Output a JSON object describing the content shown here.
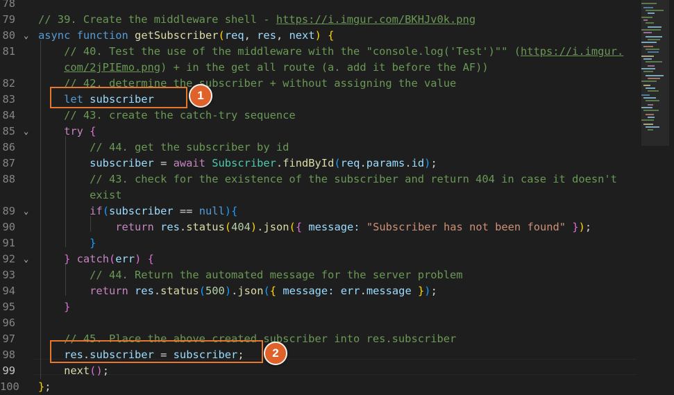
{
  "editor": {
    "language": "javascript",
    "current_line": 99,
    "lines": [
      {
        "num": "78",
        "tokens": []
      },
      {
        "num": "79",
        "fold": false,
        "tokens": [
          {
            "c": "cm",
            "t": "// 39. Create the middleware shell - "
          },
          {
            "c": "ln-link",
            "t": "https://i.imgur.com/BKHJv0k.png"
          }
        ]
      },
      {
        "num": "80",
        "fold": true,
        "tokens": [
          {
            "c": "kw",
            "t": "async"
          },
          {
            "c": "pn",
            "t": " "
          },
          {
            "c": "kw",
            "t": "function"
          },
          {
            "c": "pn",
            "t": " "
          },
          {
            "c": "fn",
            "t": "getSubscriber"
          },
          {
            "c": "br1",
            "t": "("
          },
          {
            "c": "vr",
            "t": "req"
          },
          {
            "c": "pn",
            "t": ", "
          },
          {
            "c": "vr",
            "t": "res"
          },
          {
            "c": "pn",
            "t": ", "
          },
          {
            "c": "vr",
            "t": "next"
          },
          {
            "c": "br1",
            "t": ")"
          },
          {
            "c": "pn",
            "t": " "
          },
          {
            "c": "br1",
            "t": "{"
          }
        ]
      },
      {
        "num": "81",
        "tokens": [
          {
            "c": "pn",
            "t": "    "
          },
          {
            "c": "cm",
            "t": "// 40. Test the use of the middleware with the \"console.log('Test')\"\" ("
          },
          {
            "c": "ln-link",
            "t": "https://i.imgur."
          }
        ]
      },
      {
        "num": "",
        "tokens": [
          {
            "c": "pn",
            "t": "    "
          },
          {
            "c": "ln-link",
            "t": "com/2jPIEmo.png"
          },
          {
            "c": "cm",
            "t": ") + in the get all route (a. add it before the AF))"
          }
        ]
      },
      {
        "num": "82",
        "tokens": [
          {
            "c": "pn",
            "t": "    "
          },
          {
            "c": "cm",
            "t": "// 42. determine the subscriber + without assigning the value"
          }
        ]
      },
      {
        "num": "83",
        "tokens": [
          {
            "c": "pn",
            "t": "    "
          },
          {
            "c": "kw",
            "t": "let"
          },
          {
            "c": "pn",
            "t": " "
          },
          {
            "c": "vr",
            "t": "subscriber"
          }
        ]
      },
      {
        "num": "84",
        "tokens": [
          {
            "c": "pn",
            "t": "    "
          },
          {
            "c": "cm",
            "t": "// 43. create the catch-try sequence"
          }
        ]
      },
      {
        "num": "85",
        "fold": true,
        "tokens": [
          {
            "c": "pn",
            "t": "    "
          },
          {
            "c": "kwc",
            "t": "try"
          },
          {
            "c": "pn",
            "t": " "
          },
          {
            "c": "br2",
            "t": "{"
          }
        ]
      },
      {
        "num": "86",
        "tokens": [
          {
            "c": "pn",
            "t": "        "
          },
          {
            "c": "cm",
            "t": "// 44. get the subscriber by id"
          }
        ]
      },
      {
        "num": "87",
        "tokens": [
          {
            "c": "pn",
            "t": "        "
          },
          {
            "c": "vr",
            "t": "subscriber"
          },
          {
            "c": "pn",
            "t": " = "
          },
          {
            "c": "kwc",
            "t": "await"
          },
          {
            "c": "pn",
            "t": " "
          },
          {
            "c": "cls",
            "t": "Subscriber"
          },
          {
            "c": "pn",
            "t": "."
          },
          {
            "c": "fn",
            "t": "findById"
          },
          {
            "c": "br3",
            "t": "("
          },
          {
            "c": "vr",
            "t": "req"
          },
          {
            "c": "pn",
            "t": "."
          },
          {
            "c": "vr",
            "t": "params"
          },
          {
            "c": "pn",
            "t": "."
          },
          {
            "c": "vr",
            "t": "id"
          },
          {
            "c": "br3",
            "t": ")"
          },
          {
            "c": "pn",
            "t": ";"
          }
        ]
      },
      {
        "num": "88",
        "tokens": [
          {
            "c": "pn",
            "t": "        "
          },
          {
            "c": "cm",
            "t": "// 43. check for the existence of the subscriber and return 404 in case it doesn't"
          }
        ]
      },
      {
        "num": "",
        "tokens": [
          {
            "c": "pn",
            "t": "        "
          },
          {
            "c": "cm",
            "t": "exist"
          }
        ]
      },
      {
        "num": "89",
        "fold": true,
        "tokens": [
          {
            "c": "pn",
            "t": "        "
          },
          {
            "c": "kwc",
            "t": "if"
          },
          {
            "c": "br3",
            "t": "("
          },
          {
            "c": "vr",
            "t": "subscriber"
          },
          {
            "c": "pn",
            "t": " == "
          },
          {
            "c": "kw",
            "t": "null"
          },
          {
            "c": "br3",
            "t": ")"
          },
          {
            "c": "br3",
            "t": "{"
          }
        ]
      },
      {
        "num": "90",
        "tokens": [
          {
            "c": "pn",
            "t": "            "
          },
          {
            "c": "kwc",
            "t": "return"
          },
          {
            "c": "pn",
            "t": " "
          },
          {
            "c": "vr",
            "t": "res"
          },
          {
            "c": "pn",
            "t": "."
          },
          {
            "c": "fn",
            "t": "status"
          },
          {
            "c": "br1",
            "t": "("
          },
          {
            "c": "nm",
            "t": "404"
          },
          {
            "c": "br1",
            "t": ")"
          },
          {
            "c": "pn",
            "t": "."
          },
          {
            "c": "fn",
            "t": "json"
          },
          {
            "c": "br1",
            "t": "("
          },
          {
            "c": "br2",
            "t": "{"
          },
          {
            "c": "pn",
            "t": " "
          },
          {
            "c": "vr",
            "t": "message"
          },
          {
            "c": "vr",
            "t": ":"
          },
          {
            "c": "pn",
            "t": " "
          },
          {
            "c": "st",
            "t": "\"Subscriber has not been found\""
          },
          {
            "c": "pn",
            "t": " "
          },
          {
            "c": "br2",
            "t": "}"
          },
          {
            "c": "br1",
            "t": ")"
          },
          {
            "c": "pn",
            "t": ";"
          }
        ]
      },
      {
        "num": "91",
        "tokens": [
          {
            "c": "pn",
            "t": "        "
          },
          {
            "c": "br3",
            "t": "}"
          }
        ]
      },
      {
        "num": "92",
        "fold": true,
        "tokens": [
          {
            "c": "pn",
            "t": "    "
          },
          {
            "c": "br2",
            "t": "}"
          },
          {
            "c": "pn",
            "t": " "
          },
          {
            "c": "kwc",
            "t": "catch"
          },
          {
            "c": "br2",
            "t": "("
          },
          {
            "c": "vr",
            "t": "err"
          },
          {
            "c": "br2",
            "t": ")"
          },
          {
            "c": "pn",
            "t": " "
          },
          {
            "c": "br2",
            "t": "{"
          }
        ]
      },
      {
        "num": "93",
        "tokens": [
          {
            "c": "pn",
            "t": "        "
          },
          {
            "c": "cm",
            "t": "// 44. Return the automated message for the server problem"
          }
        ]
      },
      {
        "num": "94",
        "tokens": [
          {
            "c": "pn",
            "t": "        "
          },
          {
            "c": "kwc",
            "t": "return"
          },
          {
            "c": "pn",
            "t": " "
          },
          {
            "c": "vr",
            "t": "res"
          },
          {
            "c": "pn",
            "t": "."
          },
          {
            "c": "fn",
            "t": "status"
          },
          {
            "c": "br3",
            "t": "("
          },
          {
            "c": "nm",
            "t": "500"
          },
          {
            "c": "br3",
            "t": ")"
          },
          {
            "c": "pn",
            "t": "."
          },
          {
            "c": "fn",
            "t": "json"
          },
          {
            "c": "br3",
            "t": "("
          },
          {
            "c": "br1",
            "t": "{"
          },
          {
            "c": "pn",
            "t": " "
          },
          {
            "c": "vr",
            "t": "message"
          },
          {
            "c": "vr",
            "t": ":"
          },
          {
            "c": "pn",
            "t": " "
          },
          {
            "c": "vr",
            "t": "err"
          },
          {
            "c": "pn",
            "t": "."
          },
          {
            "c": "vr",
            "t": "message"
          },
          {
            "c": "pn",
            "t": " "
          },
          {
            "c": "br1",
            "t": "}"
          },
          {
            "c": "br3",
            "t": ")"
          },
          {
            "c": "pn",
            "t": ";"
          }
        ]
      },
      {
        "num": "95",
        "tokens": [
          {
            "c": "pn",
            "t": "    "
          },
          {
            "c": "br2",
            "t": "}"
          }
        ]
      },
      {
        "num": "96",
        "tokens": []
      },
      {
        "num": "97",
        "tokens": [
          {
            "c": "pn",
            "t": "    "
          },
          {
            "c": "cm",
            "t": "// 45. Place the above created subscriber into res.subscriber"
          }
        ]
      },
      {
        "num": "98",
        "tokens": [
          {
            "c": "pn",
            "t": "    "
          },
          {
            "c": "vr",
            "t": "res"
          },
          {
            "c": "pn",
            "t": "."
          },
          {
            "c": "vr",
            "t": "subscriber"
          },
          {
            "c": "pn",
            "t": " = "
          },
          {
            "c": "vr",
            "t": "subscriber"
          },
          {
            "c": "pn",
            "t": ";"
          }
        ]
      },
      {
        "num": "99",
        "tokens": [
          {
            "c": "pn",
            "t": "    "
          },
          {
            "c": "fn",
            "t": "next"
          },
          {
            "c": "br2",
            "t": "("
          },
          {
            "c": "br2",
            "t": ")"
          },
          {
            "c": "pn",
            "t": ";"
          }
        ]
      },
      {
        "num": "100",
        "tokens": [
          {
            "c": "br1",
            "t": "}"
          },
          {
            "c": "pn",
            "t": ";"
          }
        ]
      }
    ]
  },
  "annotations": [
    {
      "label": "1",
      "target_line": "83",
      "color": "#e8772e"
    },
    {
      "label": "2",
      "target_line": "98",
      "color": "#e8772e"
    }
  ],
  "colors": {
    "background": "#1e1e1e",
    "line_number": "#858585",
    "comment": "#6a9955",
    "keyword": "#569cd6",
    "control_keyword": "#c586c0",
    "function": "#dcdcaa",
    "variable": "#9cdcfe",
    "class": "#4ec9b0",
    "string": "#ce9178",
    "number": "#b5cea8",
    "annotation": "#e8772e"
  }
}
